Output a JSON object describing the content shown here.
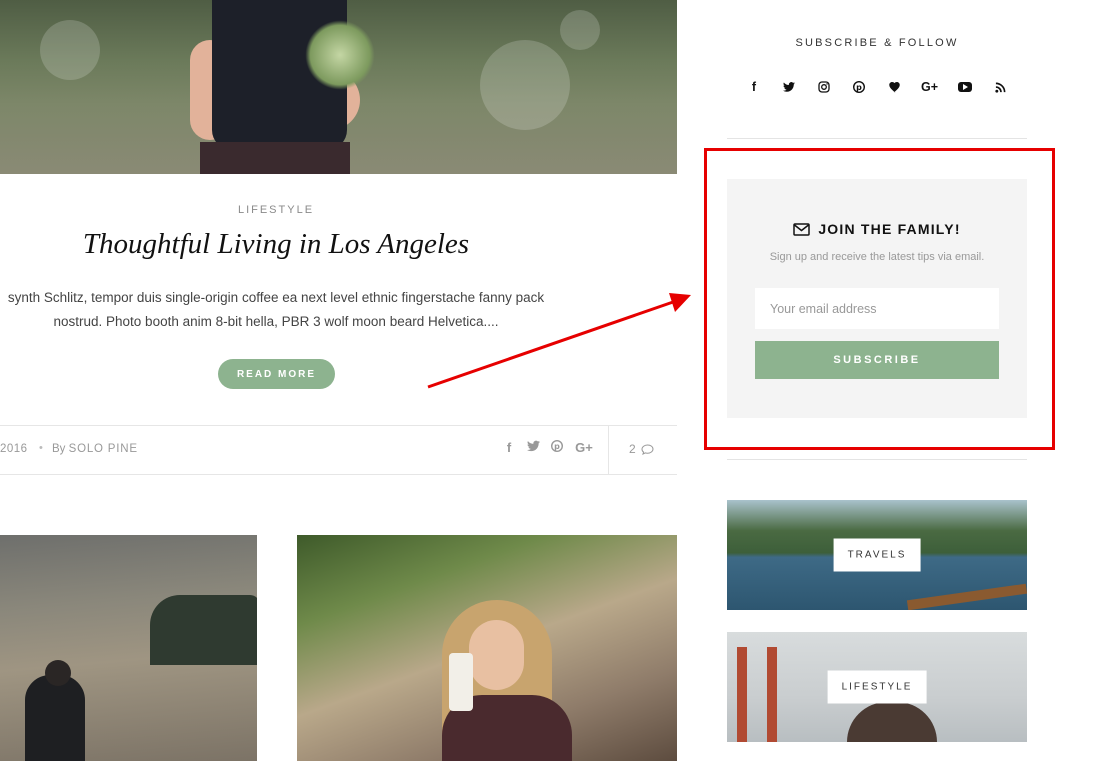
{
  "post": {
    "category": "LIFESTYLE",
    "title": "Thoughtful Living in Los Angeles",
    "excerpt_line1": "synth Schlitz, tempor duis single-origin coffee ea next level ethnic fingerstache fanny pack",
    "excerpt_line2": "nostrud. Photo booth anim 8-bit hella, PBR 3 wolf moon beard Helvetica....",
    "read_more": "READ MORE",
    "date": "2016",
    "by": "By",
    "author": "SOLO PINE",
    "comment_count": "2",
    "share_icons": [
      "facebook-icon",
      "twitter-icon",
      "pinterest-icon",
      "google-plus-icon"
    ]
  },
  "sidebar": {
    "follow_title": "SUBSCRIBE & FOLLOW",
    "social_icons": [
      "facebook-icon",
      "twitter-icon",
      "instagram-icon",
      "pinterest-icon",
      "heart-icon",
      "google-plus-icon",
      "youtube-icon",
      "rss-icon"
    ],
    "newsletter": {
      "title": "JOIN THE FAMILY!",
      "subtitle": "Sign up and receive the latest tips via email.",
      "email_placeholder": "Your email address",
      "button": "SUBSCRIBE"
    },
    "categories": [
      {
        "label": "TRAVELS"
      },
      {
        "label": "LIFESTYLE"
      }
    ]
  },
  "colors": {
    "accent": "#8db38f",
    "highlight": "#e60000"
  }
}
